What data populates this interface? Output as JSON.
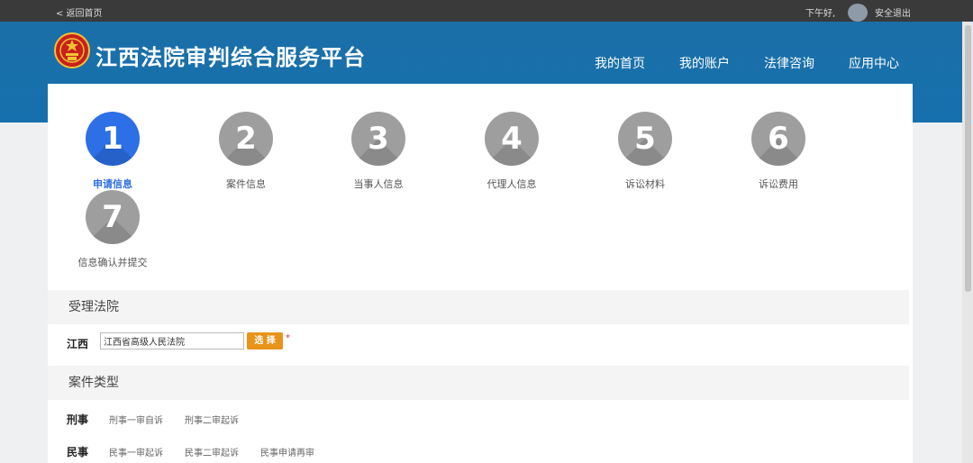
{
  "topbar": {
    "back_link": "< 返回首页",
    "greeting": "下午好,",
    "logout": "安全退出"
  },
  "header": {
    "title": "江西法院审判综合服务平台",
    "nav": [
      "我的首页",
      "我的账户",
      "法律咨询",
      "应用中心"
    ]
  },
  "steps": [
    {
      "num": "1",
      "label": "申请信息",
      "active": true
    },
    {
      "num": "2",
      "label": "案件信息",
      "active": false
    },
    {
      "num": "3",
      "label": "当事人信息",
      "active": false
    },
    {
      "num": "4",
      "label": "代理人信息",
      "active": false
    },
    {
      "num": "5",
      "label": "诉讼材料",
      "active": false
    },
    {
      "num": "6",
      "label": "诉讼费用",
      "active": false
    },
    {
      "num": "7",
      "label": "信息确认并提交",
      "active": false
    }
  ],
  "court_section": {
    "title": "受理法院",
    "province_label": "江西",
    "court_value": "江西省高级人民法院",
    "select_button": "选 择",
    "required_mark": "*"
  },
  "case_type_section": {
    "title": "案件类型",
    "criminal": {
      "label": "刑事",
      "options": [
        "刑事一审自诉",
        "刑事二审起诉"
      ]
    },
    "civil": {
      "label": "民事",
      "options": [
        "民事一审起诉",
        "民事二审起诉",
        "民事申请再审"
      ]
    }
  },
  "colors": {
    "header_blue": "#1670ad",
    "active_step": "#2c6fe6",
    "inactive_step": "#9e9e9e",
    "button_orange": "#e8931a"
  }
}
